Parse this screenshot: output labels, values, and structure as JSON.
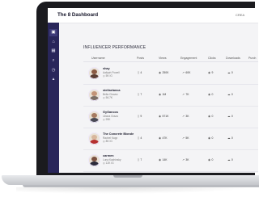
{
  "app": {
    "title": "The 8 Dashboard",
    "topbar_right": "CREA"
  },
  "sidebar": {
    "icons": [
      "calendar-icon",
      "home-icon",
      "grid-icon",
      "search-icon",
      "clock-icon",
      "chart-icon"
    ],
    "glyphs": [
      "▣",
      "⌂",
      "▦",
      "⌕",
      "◷",
      "▴"
    ],
    "active_index": 0
  },
  "section": {
    "title": "INFLUENCER PERFORMANCE"
  },
  "columns": [
    "Username",
    "Posts",
    "Views",
    "Engagement",
    "Clicks",
    "Downloads",
    "Purch"
  ],
  "rows": [
    {
      "name": "shay",
      "line2": "Aaliyah Powell",
      "line3": "◎ 5K IG",
      "posts": "4",
      "views": "250K",
      "engagement": "60K",
      "clicks": "9",
      "downloads": "0",
      "avatar": "#8a5a44",
      "shirt": "#5b3d33"
    },
    {
      "name": "stellaelanca",
      "line2": "Bella Chavez",
      "line3": "◎ 56.7K",
      "posts": "7",
      "views": "1M",
      "engagement": "7K",
      "clicks": "0",
      "downloads": "0",
      "avatar": "#c29377",
      "shirt": "#7b6e65"
    },
    {
      "name": "GyGancos",
      "line2": "Liliana Graza",
      "line3": "◎ 99K",
      "posts": "9",
      "views": "571K",
      "engagement": "3K",
      "clicks": "0",
      "downloads": "0",
      "avatar": "#a67a61",
      "shirt": "#4a4a55"
    },
    {
      "name": "The Concrete Blonde",
      "line2": "Rachel Kapp",
      "line3": "◎ 8K IG",
      "posts": "4",
      "views": "47K",
      "engagement": "5K",
      "clicks": "0",
      "downloads": "0",
      "avatar": "#d8b79c",
      "shirt": "#b5312f"
    },
    {
      "name": "carmen",
      "line2": "Luna Kachinsky",
      "line3": "◎ 12K IG",
      "posts": "7",
      "views": "14K",
      "engagement": "3K",
      "clicks": "0",
      "downloads": "0",
      "avatar": "#7b5140",
      "shirt": "#2b2b3a"
    }
  ],
  "colors": {
    "sidebar": "#29265a",
    "accent": "#3d3a78",
    "screen_bg": "#f4f4f6"
  }
}
